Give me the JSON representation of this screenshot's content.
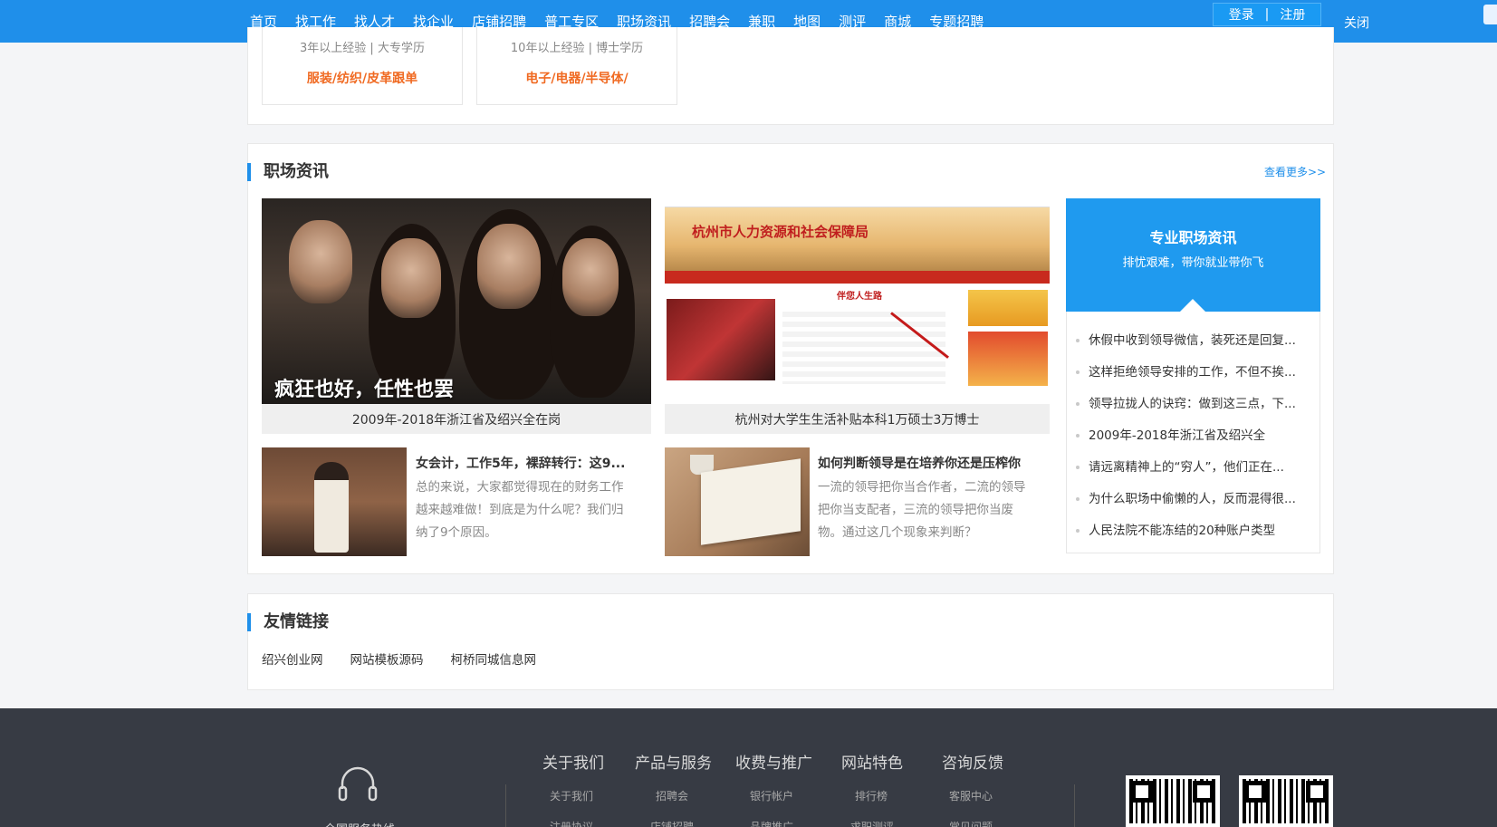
{
  "nav": {
    "items": [
      "首页",
      "找工作",
      "找人才",
      "找企业",
      "店铺招聘",
      "普工专区",
      "职场资讯",
      "招聘会",
      "兼职",
      "地图",
      "测评",
      "商城",
      "专题招聘"
    ],
    "login": "登录",
    "separator": "|",
    "register": "注册",
    "close": "关闭"
  },
  "top_jobs": [
    {
      "meta": "3年以上经验 | 大专学历",
      "category": "服装/纺织/皮革跟单"
    },
    {
      "meta": "10年以上经验 | 博士学历",
      "category": "电子/电器/半导体/"
    }
  ],
  "career_news": {
    "title": "职场资讯",
    "more": "查看更多>>",
    "featured": [
      {
        "caption": "2009年-2018年浙江省及绍兴全在岗",
        "overlay": "疯狂也好，任性也罢"
      },
      {
        "caption": "杭州对大学生生活补贴本科1万硕士3万博士",
        "site_title": "杭州市人力资源和社会保障局",
        "site_tag": "伴您人生路"
      }
    ],
    "articles": [
      {
        "title": "女会计，工作5年，裸辞转行：这9...",
        "desc": "总的来说，大家都觉得现在的财务工作越来越难做！到底是为什么呢？我们归纳了9个原因。"
      },
      {
        "title": "如何判断领导是在培养你还是压榨你",
        "desc": "一流的领导把你当合作者，二流的领导把你当支配者，三流的领导把你当废物。通过这几个现象来判断？"
      }
    ],
    "pro": {
      "heading": "专业职场资讯",
      "subheading": "排忧艰难，带你就业带你飞",
      "items": [
        "休假中收到领导微信，装死还是回复...",
        "这样拒绝领导安排的工作，不但不挨...",
        "领导拉拢人的诀窍：做到这三点，下...",
        "2009年-2018年浙江省及绍兴全",
        "请远离精神上的“穷人”，他们正在...",
        "为什么职场中偷懒的人，反而混得很...",
        "人民法院不能冻结的20种账户类型"
      ]
    }
  },
  "friend_links": {
    "title": "友情链接",
    "items": [
      "绍兴创业网",
      "网站模板源码",
      "柯桥同城信息网"
    ]
  },
  "footer": {
    "service_label": "全国服务热线",
    "columns": [
      {
        "title": "关于我们",
        "links": [
          "关于我们",
          "注册协议"
        ]
      },
      {
        "title": "产品与服务",
        "links": [
          "招聘会",
          "店铺招聘"
        ]
      },
      {
        "title": "收费与推广",
        "links": [
          "银行帐户",
          "品牌推广"
        ]
      },
      {
        "title": "网站特色",
        "links": [
          "排行榜",
          "求职测评"
        ]
      },
      {
        "title": "咨询反馈",
        "links": [
          "客服中心",
          "常见问题"
        ]
      }
    ]
  },
  "colors": {
    "accent": "#1f8fea",
    "highlight": "#f06a22",
    "footer_bg": "#373b44"
  },
  "icons": [
    "headset-icon",
    "qr-code-icon"
  ]
}
